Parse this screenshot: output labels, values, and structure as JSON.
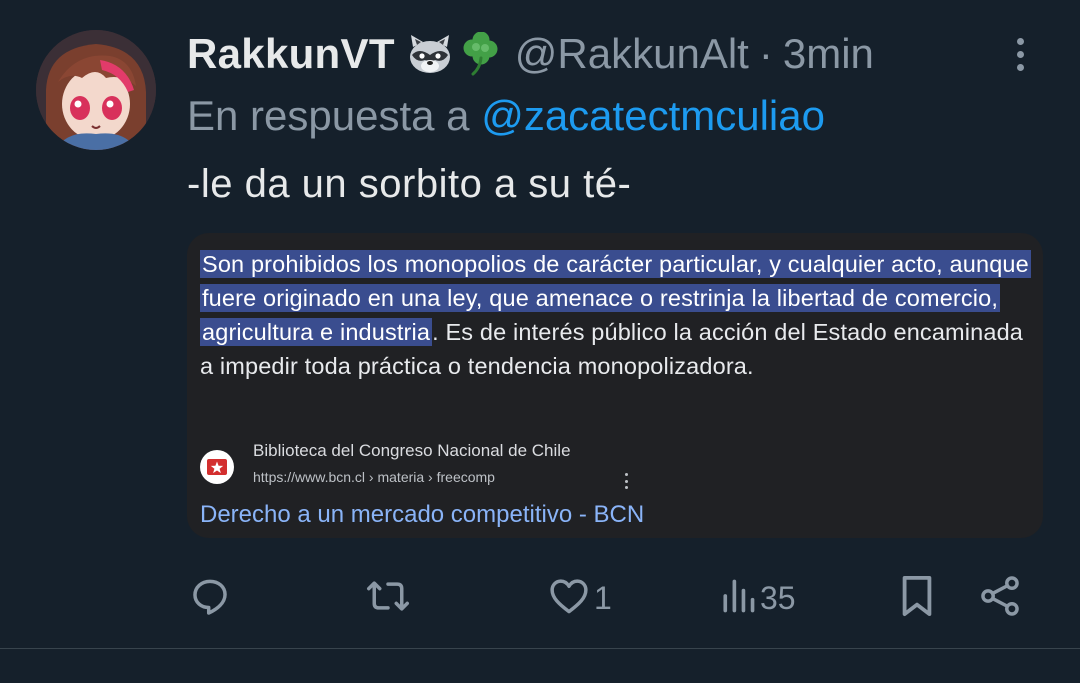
{
  "tweet": {
    "display_name": "RakkunVT",
    "name_emojis": [
      "raccoon-emoji",
      "shamrock-emoji"
    ],
    "handle": "@RakkunAlt",
    "separator": "·",
    "time": "3min",
    "reply_prefix": "En respuesta a",
    "reply_to": "@zacatectmculiao",
    "text": "-le da un sorbito a su té-"
  },
  "attached_image": {
    "snippet_highlighted": "Son prohibidos los monopolios de carácter particular, y cualquier acto, aunque fuere originado en una ley, que amenace o restrinja la libertad de comercio, agricultura e industria",
    "snippet_rest": ". Es de interés público la acción del Estado encaminada a impedir toda práctica o tendencia monopolizadora.",
    "source_name": "Biblioteca del Congreso Nacional de Chile",
    "source_url": "https://www.bcn.cl › materia › freecomp",
    "result_title": "Derecho a un mercado competitivo - BCN"
  },
  "actions": {
    "reply_count": "",
    "retweet_count": "",
    "like_count": "1",
    "views_count": "35"
  },
  "colors": {
    "background": "#15202b",
    "primary_text": "#e7e9ea",
    "secondary_text": "#8b98a5",
    "accent": "#1d9bf0",
    "highlight": "#3a4d8f",
    "link": "#8ab4f8"
  }
}
